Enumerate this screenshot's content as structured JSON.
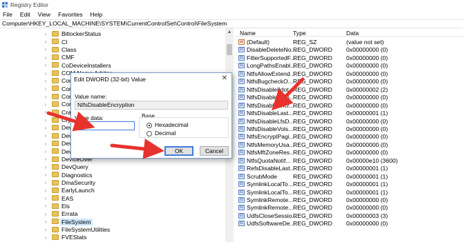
{
  "window": {
    "title": "Registry Editor"
  },
  "menu": [
    "File",
    "Edit",
    "View",
    "Favorites",
    "Help"
  ],
  "address": "Computer\\HKEY_LOCAL_MACHINE\\SYSTEM\\CurrentControlSet\\Control\\FileSystem",
  "tree": {
    "items": [
      "BitlockerStatus",
      "CI",
      "Class",
      "CMF",
      "CoDeviceInstallers",
      "COM Name Arbiter",
      "CommonGl",
      "Compatibili",
      "ComputerN",
      "ContentInd",
      "CrashContr",
      "Cryptograp",
      "DeviceCla",
      "DeviceCont",
      "DeviceCont",
      "DeviceGuar",
      "DeviceOver",
      "DevQuery",
      "Diagnostics",
      "DmaSecurity",
      "EarlyLaunch",
      "EAS",
      "Els",
      "Errata",
      "FileSystem",
      "FileSystemUtilities",
      "FVEStats"
    ],
    "selected": "FileSystem"
  },
  "values_pane": {
    "headers": {
      "name": "Name",
      "type": "Type",
      "data": "Data"
    },
    "rows": [
      {
        "name": "(Default)",
        "type": "REG_SZ",
        "data": "(value not set)",
        "icon": "ab"
      },
      {
        "name": "DisableDeleteNo...",
        "type": "REG_DWORD",
        "data": "0x00000000 (0)",
        "icon": "dword"
      },
      {
        "name": "FilterSupportedF...",
        "type": "REG_DWORD",
        "data": "0x00000000 (0)",
        "icon": "dword"
      },
      {
        "name": "LongPathsEnabl...",
        "type": "REG_DWORD",
        "data": "0x00000000 (0)",
        "icon": "dword"
      },
      {
        "name": "NtfsAllowExtend...",
        "type": "REG_DWORD",
        "data": "0x00000000 (0)",
        "icon": "dword"
      },
      {
        "name": "NtfsBugcheckO...",
        "type": "REG_DWORD",
        "data": "0x00000000 (0)",
        "icon": "dword"
      },
      {
        "name": "NtfsDisable8dot...",
        "type": "REG_DWORD",
        "data": "0x00000002 (2)",
        "icon": "dword"
      },
      {
        "name": "NtfsDisableCom...",
        "type": "REG_DWORD",
        "data": "0x00000000 (0)",
        "icon": "dword"
      },
      {
        "name": "NtfsDisableEncr...",
        "type": "REG_DWORD",
        "data": "0x00000000 (0)",
        "icon": "dword"
      },
      {
        "name": "NtfsDisableLast...",
        "type": "REG_DWORD",
        "data": "0x00000001 (1)",
        "icon": "dword"
      },
      {
        "name": "NtfsDisableLfsD...",
        "type": "REG_DWORD",
        "data": "0x00000000 (0)",
        "icon": "dword"
      },
      {
        "name": "NtfsDisableVols...",
        "type": "REG_DWORD",
        "data": "0x00000000 (0)",
        "icon": "dword"
      },
      {
        "name": "NtfsEncryptPagi...",
        "type": "REG_DWORD",
        "data": "0x00000000 (0)",
        "icon": "dword"
      },
      {
        "name": "NtfsMemoryUsa...",
        "type": "REG_DWORD",
        "data": "0x00000000 (0)",
        "icon": "dword"
      },
      {
        "name": "NtfsMftZoneRes...",
        "type": "REG_DWORD",
        "data": "0x00000000 (0)",
        "icon": "dword"
      },
      {
        "name": "NtfsQuotaNotif...",
        "type": "REG_DWORD",
        "data": "0x00000e10 (3600)",
        "icon": "dword"
      },
      {
        "name": "RefsDisableLast...",
        "type": "REG_DWORD",
        "data": "0x00000001 (1)",
        "icon": "dword"
      },
      {
        "name": "ScrubMode",
        "type": "REG_DWORD",
        "data": "0x00000001 (1)",
        "icon": "dword"
      },
      {
        "name": "SymlinkLocalTo...",
        "type": "REG_DWORD",
        "data": "0x00000001 (1)",
        "icon": "dword"
      },
      {
        "name": "SymlinkLocalTo...",
        "type": "REG_DWORD",
        "data": "0x00000001 (1)",
        "icon": "dword"
      },
      {
        "name": "SymlinkRemote...",
        "type": "REG_DWORD",
        "data": "0x00000000 (0)",
        "icon": "dword"
      },
      {
        "name": "SymlinkRemote...",
        "type": "REG_DWORD",
        "data": "0x00000000 (0)",
        "icon": "dword"
      },
      {
        "name": "UdfsCloseSessio...",
        "type": "REG_DWORD",
        "data": "0x00000003 (3)",
        "icon": "dword"
      },
      {
        "name": "UdfsSoftwareDe...",
        "type": "REG_DWORD",
        "data": "0x00000000 (0)",
        "icon": "dword"
      }
    ]
  },
  "dialog": {
    "title": "Edit DWORD (32-bit) Value",
    "close": "✕",
    "value_name_label": "Value name:",
    "value_name": "NtfsDisableEncryption",
    "value_data_label": "Value data:",
    "value_data": "1",
    "base_label": "Base",
    "hex_label": "Hexadecimal",
    "dec_label": "Decimal",
    "base_selected": "Hexadecimal",
    "ok_label": "OK",
    "cancel_label": "Cancel"
  },
  "colors": {
    "arrow": "#e8322e",
    "selection": "#cde8ff",
    "accent": "#3d7bd9"
  }
}
